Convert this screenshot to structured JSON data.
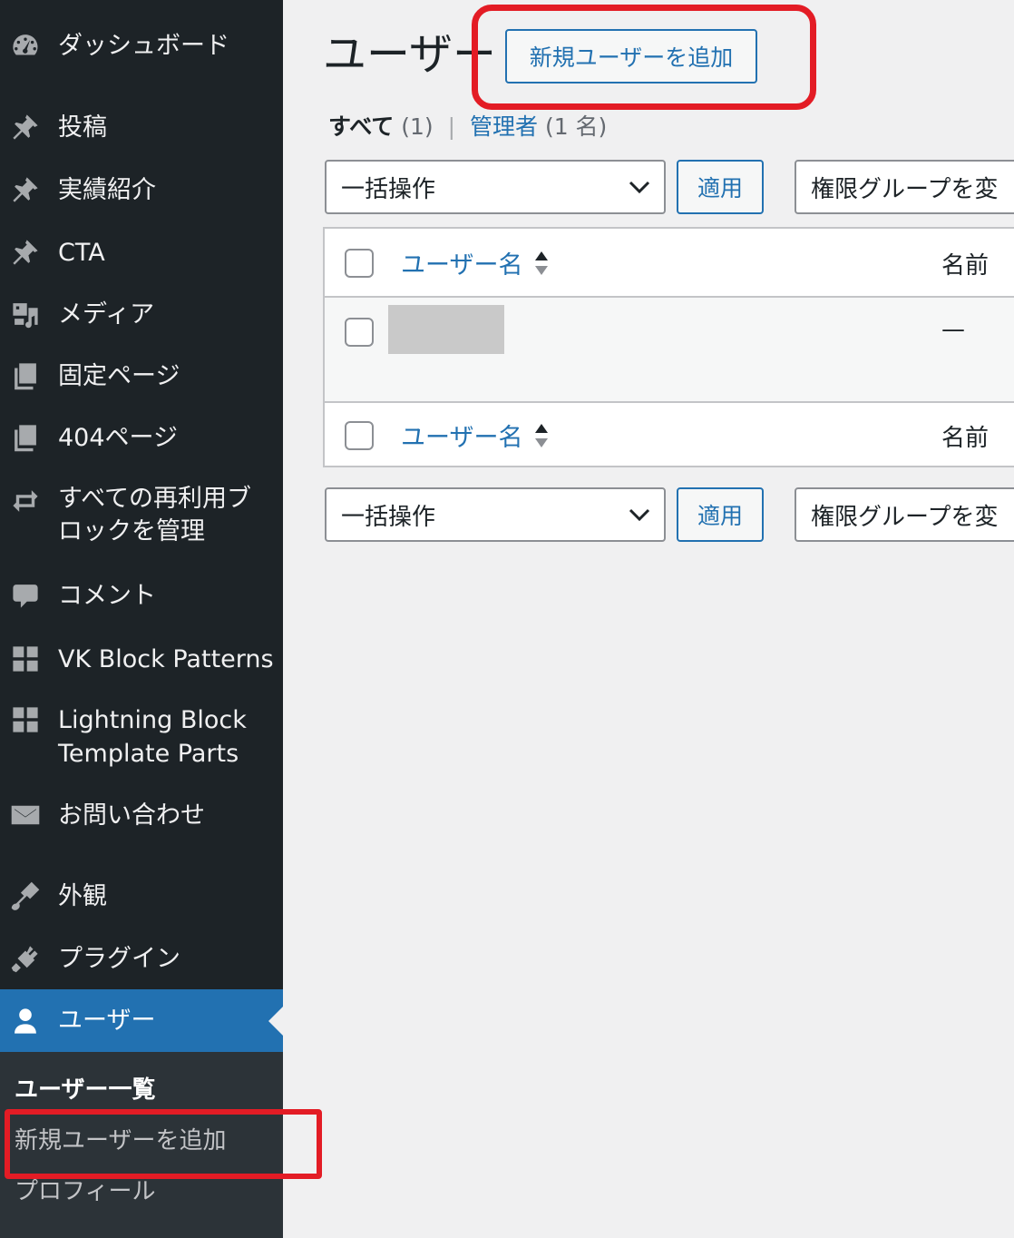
{
  "sidebar": {
    "items": [
      {
        "label": "ダッシュボード",
        "icon": "dashboard-icon"
      },
      {
        "label": "投稿",
        "icon": "pin-icon"
      },
      {
        "label": "実績紹介",
        "icon": "pin-icon"
      },
      {
        "label": "CTA",
        "icon": "pin-icon"
      },
      {
        "label": "メディア",
        "icon": "media-icon"
      },
      {
        "label": "固定ページ",
        "icon": "pages-icon"
      },
      {
        "label": "404ページ",
        "icon": "pages-icon"
      },
      {
        "label": "すべての再利用ブ\nロックを管理",
        "icon": "reuse-icon"
      },
      {
        "label": "コメント",
        "icon": "comment-icon"
      },
      {
        "label": "VK Block Patterns",
        "icon": "grid-icon"
      },
      {
        "label": "Lightning Block\nTemplate Parts",
        "icon": "grid-icon"
      },
      {
        "label": "お問い合わせ",
        "icon": "mail-icon"
      },
      {
        "label": "外観",
        "icon": "brush-icon"
      },
      {
        "label": "プラグイン",
        "icon": "plugin-icon"
      },
      {
        "label": "ユーザー",
        "icon": "user-icon"
      }
    ],
    "submenu": [
      {
        "label": "ユーザー一覧"
      },
      {
        "label": "新規ユーザーを追加"
      },
      {
        "label": "プロフィール"
      }
    ]
  },
  "main": {
    "title": "ユーザー",
    "add_new_label": "新規ユーザーを追加",
    "filters": {
      "all_label": "すべて",
      "all_count": "(1)",
      "separator": "|",
      "admin_label": "管理者",
      "admin_count": "(1 名)"
    },
    "bulk_action": "一括操作",
    "apply_label": "適用",
    "role_change": "権限グループを変",
    "table": {
      "col_username": "ユーザー名",
      "col_name": "名前",
      "row_name_value": "—"
    }
  },
  "colors": {
    "sidebar_bg": "#1d2327",
    "accent": "#2271b1",
    "highlight": "#e31c25"
  }
}
